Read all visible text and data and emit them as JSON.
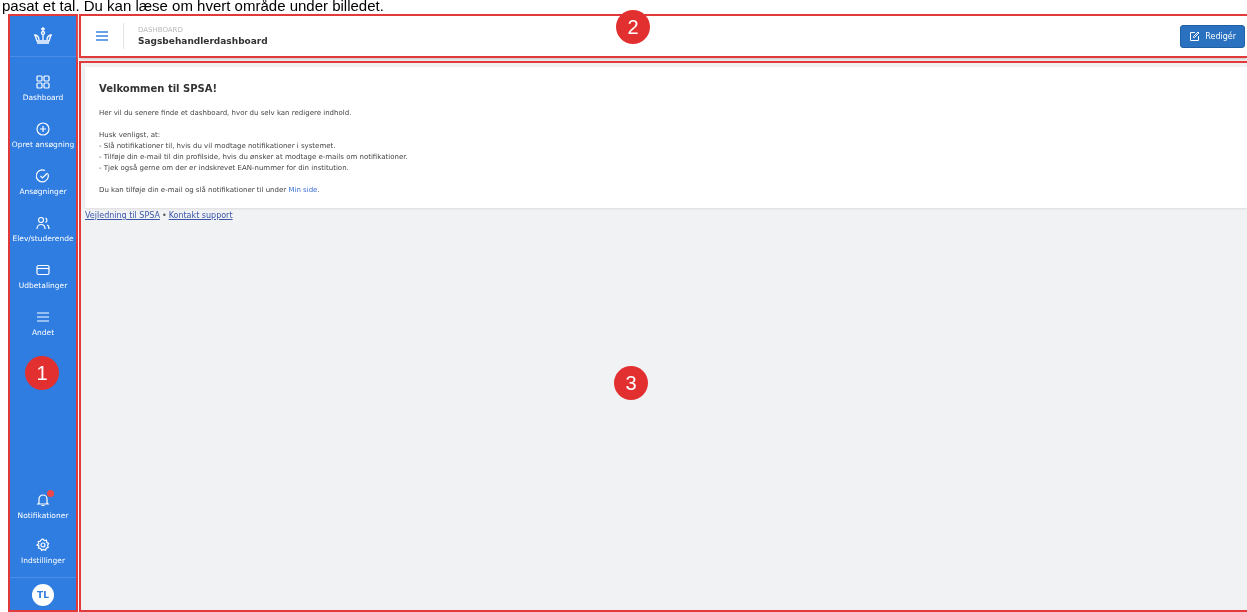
{
  "caption": "pasat et tal. Du kan læse om hvert område under billedet.",
  "sidebar": {
    "items": [
      {
        "label": "Dashboard",
        "selected": false
      },
      {
        "label": "Opret ansøgning",
        "selected": false
      },
      {
        "label": "Ansøgninger",
        "selected": false
      },
      {
        "label": "Elev/studerende",
        "selected": false
      },
      {
        "label": "Udbetalinger",
        "selected": false
      },
      {
        "label": "Andet",
        "selected": false
      }
    ],
    "bottom_items": [
      {
        "label": "Notifikationer",
        "unread": true
      },
      {
        "label": "Indstillinger",
        "unread": false
      }
    ],
    "avatar": "TL"
  },
  "header": {
    "breadcrumb": "DASHBOARD",
    "title": "Sagsbehandlerdashboard",
    "button": "Redigér"
  },
  "card": {
    "title": "Velkommen til SPSA!",
    "intro": "Her vil du senere finde et dashboard, hvor du selv kan redigere indhold.",
    "remember": "Husk venligst, at:",
    "bullets": [
      "- Slå notifikationer til, hvis du vil modtage notifikationer i systemet.",
      "- Tilføje din e-mail til din profilside, hvis du ønsker at modtage e-mails om notifikationer.",
      "- Tjek også gerne om der er indskrevet EAN-nummer for din institution."
    ],
    "footer_text": "Du kan tilføje din e-mail og slå notifikationer til under ",
    "footer_link": "Min side",
    "footer_end": "."
  },
  "links": [
    "Vejledning til SPSA",
    "Kontakt support"
  ],
  "link_separator": "•",
  "annotations": [
    "1",
    "2",
    "3"
  ]
}
